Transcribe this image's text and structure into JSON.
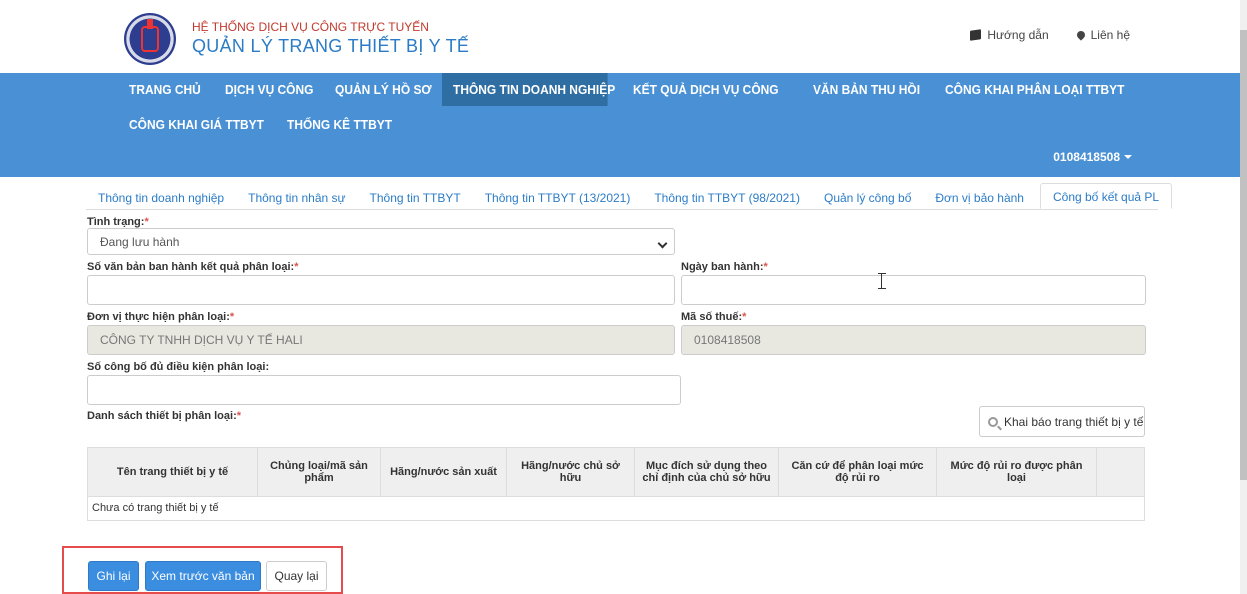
{
  "header": {
    "brand_top": "HỆ THỐNG DỊCH VỤ CÔNG TRỰC TUYẾN",
    "brand_main": "QUẢN LÝ TRANG THIẾT BỊ Y TẾ",
    "links": [
      {
        "label": "Hướng dẫn",
        "icon": "book-icon"
      },
      {
        "label": "Liên hệ",
        "icon": "map-pin-icon"
      }
    ]
  },
  "nav": {
    "row1": [
      "TRANG CHỦ",
      "DỊCH VỤ CÔNG",
      "QUẢN LÝ HỒ SƠ",
      "THÔNG TIN DOANH NGHIỆP",
      "KẾT QUẢ DỊCH VỤ CÔNG",
      "VĂN BẢN THU HỒI",
      "CÔNG KHAI PHÂN LOẠI TTBYT"
    ],
    "row2": [
      "CÔNG KHAI GIÁ TTBYT",
      "THỐNG KÊ TTBYT"
    ],
    "active": "THÔNG TIN DOANH NGHIỆP",
    "user": "0108418508"
  },
  "tabs": [
    "Thông tin doanh nghiệp",
    "Thông tin nhân sự",
    "Thông tin TTBYT",
    "Thông tin TTBYT (13/2021)",
    "Thông tin TTBYT (98/2021)",
    "Quản lý công bố",
    "Đơn vị bảo hành",
    "Công bố kết quả PL"
  ],
  "form": {
    "status_label": "Tình trạng:",
    "status_value": "Đang lưu hành",
    "doc_number_label": "Số văn bản ban hành kết quả phân loại:",
    "doc_number_value": "",
    "issue_date_label": "Ngày ban hành:",
    "issue_date_value": "",
    "org_label": "Đơn vị thực hiện phân loại:",
    "org_value": "CÔNG TY TNHH DỊCH VỤ Y TẾ HALI",
    "tax_label": "Mã số thuế:",
    "tax_value": "0108418508",
    "eligibility_label": "Số công bố đủ điều kiện phân loại:",
    "eligibility_value": "",
    "device_list_label": "Danh sách thiết bị phân loại:",
    "declare_button": "Khai báo trang thiết bị y tế",
    "required_mark": "*"
  },
  "table": {
    "headers": [
      "Tên trang thiết bị y tế",
      "Chủng loại/mã sản phẩm",
      "Hãng/nước sản xuất",
      "Hãng/nước chủ sở hữu",
      "Mục đích sử dụng theo chỉ định của chủ sở hữu",
      "Căn cứ để phân loại mức độ rủi ro",
      "Mức độ rủi ro được phân loại"
    ],
    "empty_text": "Chưa có trang thiết bị y tế"
  },
  "actions": {
    "save": "Ghi lại",
    "preview": "Xem trước văn bản",
    "back": "Quay lại"
  }
}
